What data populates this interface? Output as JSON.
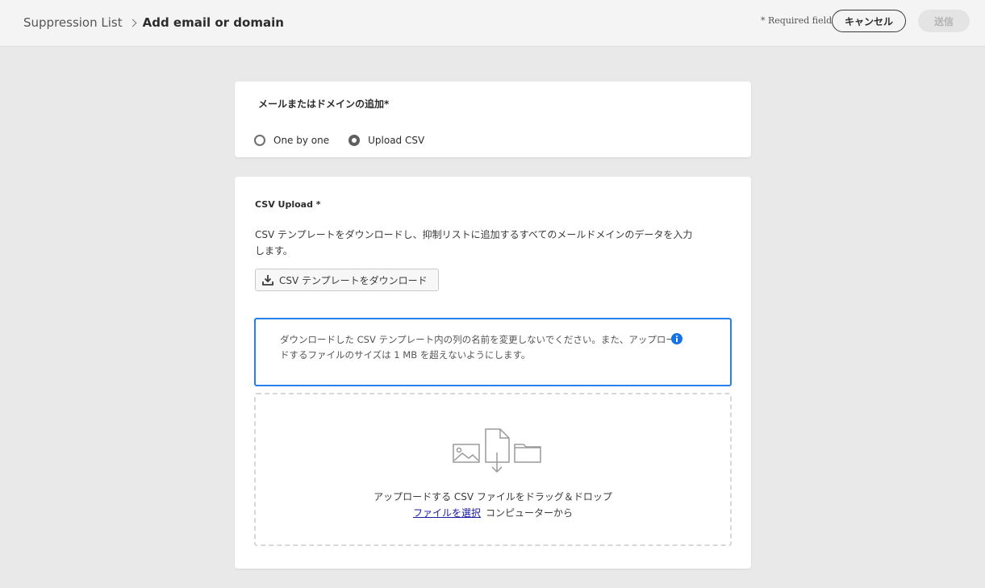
{
  "header": {
    "breadcrumb_root": "Suppression List",
    "breadcrumb_current": "Add email or domain",
    "required_note": "* Required fields",
    "cancel_label": "キャンセル",
    "submit_label": "送信"
  },
  "add_section": {
    "title": "メールまたはドメインの追加*",
    "options": [
      {
        "label": "One by one",
        "selected": false
      },
      {
        "label": "Upload CSV",
        "selected": true
      }
    ]
  },
  "csv_section": {
    "title": "CSV Upload *",
    "description": "CSV テンプレートをダウンロードし、抑制リストに追加するすべてのメールドメインのデータを入力します。",
    "download_button": "CSV テンプレートをダウンロード",
    "info_message": "ダウンロードした CSV テンプレート内の列の名前を変更しないでください。また、アップロードするファイルのサイズは 1 MB を超えないようにします。",
    "drop_text": "アップロードする CSV ファイルをドラッグ＆ドロップ",
    "select_file_link": "ファイルを選択",
    "from_computer": "コンピューターから"
  },
  "colors": {
    "accent": "#2680eb",
    "info_icon": "#1473e6",
    "link": "#1a1aa6"
  },
  "icons": [
    "chevron-right-icon",
    "download-icon",
    "info-icon",
    "image-file-icon",
    "document-icon",
    "folder-icon"
  ]
}
